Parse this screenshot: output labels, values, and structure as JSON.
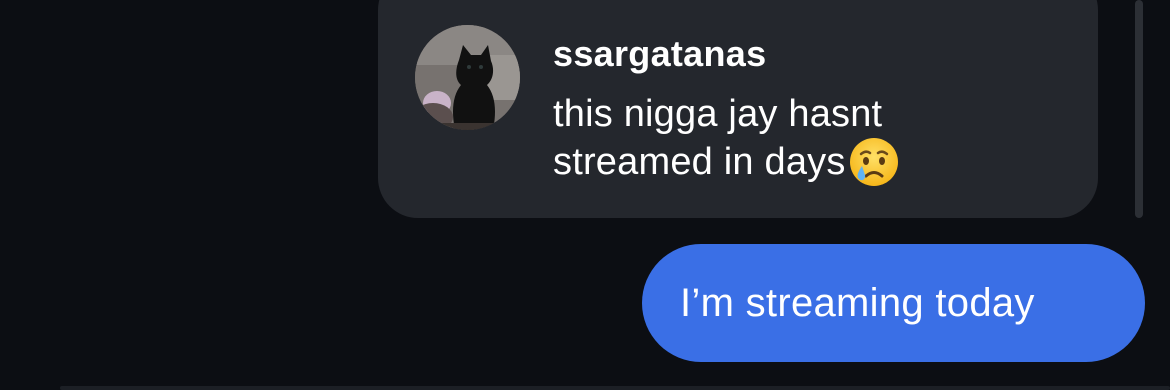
{
  "conversation": {
    "incoming": {
      "sender": "ssargatanas",
      "message": "this nigga jay hasnt streamed in days",
      "emoji": "crying-face-icon",
      "avatar": "kitten-avatar"
    },
    "outgoing": {
      "message": "I’m streaming today"
    }
  },
  "colors": {
    "background": "#0c0e13",
    "incoming_bubble": "#24272d",
    "outgoing_bubble": "#3a6fe6",
    "text": "#ffffff"
  }
}
